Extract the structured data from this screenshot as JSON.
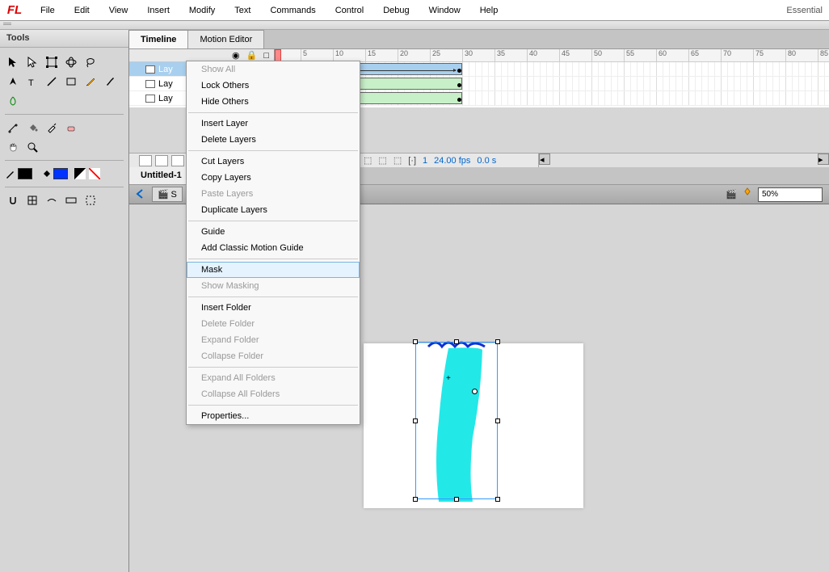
{
  "menubar": {
    "items": [
      "File",
      "Edit",
      "View",
      "Insert",
      "Modify",
      "Text",
      "Commands",
      "Control",
      "Debug",
      "Window",
      "Help"
    ],
    "workspace": "Essential"
  },
  "tools": {
    "title": "Tools"
  },
  "timeline": {
    "tabs": [
      "Timeline",
      "Motion Editor"
    ],
    "active_tab": 0,
    "layers": [
      {
        "name": "Lay",
        "selected": true
      },
      {
        "name": "Lay",
        "selected": false
      },
      {
        "name": "Lay",
        "selected": false
      }
    ],
    "ruler_start": 1,
    "ruler_end": 85,
    "ruler_step": 5,
    "playhead_frame": 1,
    "status": {
      "frame": "1",
      "fps": "24.00 fps",
      "time": "0.0 s"
    },
    "tweens": [
      {
        "layer": 0,
        "start": 1,
        "end": 30,
        "type": "motion"
      },
      {
        "layer": 1,
        "start": 1,
        "end": 30,
        "type": "green"
      },
      {
        "layer": 2,
        "start": 1,
        "end": 30,
        "type": "green"
      }
    ]
  },
  "document": {
    "tab": "Untitled-1",
    "scene": "S",
    "zoom": "50%"
  },
  "context_menu": {
    "highlighted": "Mask",
    "items": [
      {
        "label": "Show All",
        "disabled": true
      },
      {
        "label": "Lock Others",
        "disabled": false
      },
      {
        "label": "Hide Others",
        "disabled": false
      },
      {
        "sep": true
      },
      {
        "label": "Insert Layer",
        "disabled": false
      },
      {
        "label": "Delete Layers",
        "disabled": false
      },
      {
        "sep": true
      },
      {
        "label": "Cut Layers",
        "disabled": false
      },
      {
        "label": "Copy Layers",
        "disabled": false
      },
      {
        "label": "Paste Layers",
        "disabled": true
      },
      {
        "label": "Duplicate Layers",
        "disabled": false
      },
      {
        "sep": true
      },
      {
        "label": "Guide",
        "disabled": false
      },
      {
        "label": "Add Classic Motion Guide",
        "disabled": false
      },
      {
        "sep": true
      },
      {
        "label": "Mask",
        "disabled": false,
        "hover": true
      },
      {
        "label": "Show Masking",
        "disabled": true
      },
      {
        "sep": true
      },
      {
        "label": "Insert Folder",
        "disabled": false
      },
      {
        "label": "Delete Folder",
        "disabled": true
      },
      {
        "label": "Expand Folder",
        "disabled": true
      },
      {
        "label": "Collapse Folder",
        "disabled": true
      },
      {
        "sep": true
      },
      {
        "label": "Expand All Folders",
        "disabled": true
      },
      {
        "label": "Collapse All Folders",
        "disabled": true
      },
      {
        "sep": true
      },
      {
        "label": "Properties...",
        "disabled": false
      }
    ]
  },
  "colors": {
    "stroke": "#000000",
    "fill": "#0033ff",
    "cyan_shape": "#23e8e8"
  }
}
